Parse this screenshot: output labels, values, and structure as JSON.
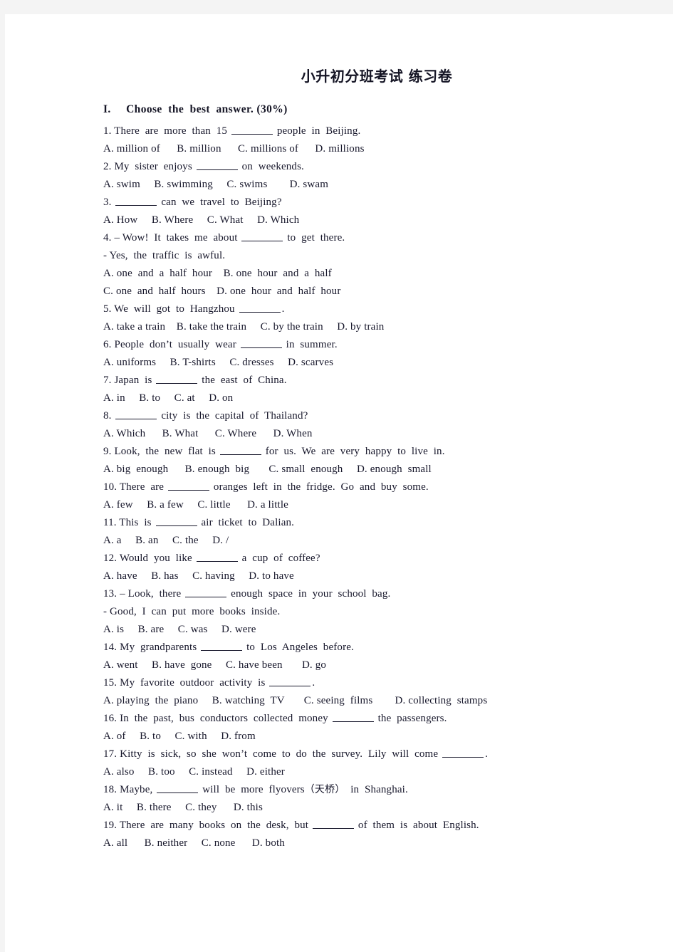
{
  "document": {
    "title": "小升初分班考试 练习卷",
    "section_heading": "I.     Choose  the  best  answer. (30%)",
    "blank_marker": "_______"
  },
  "questions": [
    {
      "number": "1.",
      "stem_before": "1. There  are  more  than  15 ",
      "stem_after": " people  in  Beijing.",
      "options": "A. million of      B. million      C. millions of      D. millions"
    },
    {
      "number": "2.",
      "stem_before": "2. My  sister  enjoys ",
      "stem_after": " on  weekends.",
      "options": "A. swim     B. swimming     C. swims        D. swam"
    },
    {
      "number": "3.",
      "stem_before": "3. ",
      "stem_after": " can  we  travel  to  Beijing?",
      "options": "A. How     B. Where     C. What     D. Which"
    },
    {
      "number": "4.",
      "stem_before": "4. – Wow!  It  takes  me  about ",
      "stem_after": " to  get  there.",
      "reply": "- Yes,  the  traffic  is  awful.",
      "options_line1": "A. one  and  a  half  hour    B. one  hour  and  a  half",
      "options_line2": "C. one  and  half  hours    D. one  hour  and  half  hour"
    },
    {
      "number": "5.",
      "stem_before": "5. We  will  got  to  Hangzhou ",
      "stem_after": ".",
      "options": "A. take a train    B. take the train     C. by the train     D. by train"
    },
    {
      "number": "6.",
      "stem_before": "6. People  don’t  usually  wear ",
      "stem_after": " in  summer.",
      "options": "A. uniforms     B. T-shirts     C. dresses     D. scarves"
    },
    {
      "number": "7.",
      "stem_before": "7. Japan  is ",
      "stem_after": " the  east  of  China.",
      "options": "A. in     B. to     C. at     D. on"
    },
    {
      "number": "8.",
      "stem_before": "8. ",
      "stem_after": " city  is  the  capital  of  Thailand?",
      "options": "A. Which      B. What      C. Where      D. When"
    },
    {
      "number": "9.",
      "stem_before": "9. Look,  the  new  flat  is ",
      "stem_after": " for  us.  We  are  very  happy  to  live  in.",
      "options": "A. big  enough      B. enough  big       C. small  enough     D. enough  small"
    },
    {
      "number": "10.",
      "stem_before": "10. There  are ",
      "stem_after": " oranges  left  in  the  fridge.  Go  and  buy  some.",
      "options": "A. few     B. a few     C. little      D. a little"
    },
    {
      "number": "11.",
      "stem_before": "11. This  is ",
      "stem_after": " air  ticket  to  Dalian.",
      "options": "A. a     B. an     C. the     D. /"
    },
    {
      "number": "12.",
      "stem_before": "12. Would  you  like ",
      "stem_after": " a  cup  of  coffee?",
      "options": "A. have     B. has     C. having     D. to have"
    },
    {
      "number": "13.",
      "stem_before": "13. – Look,  there ",
      "stem_after": " enough  space  in  your  school  bag.",
      "reply": "- Good,  I  can  put  more  books  inside.",
      "options": "A. is     B. are     C. was     D. were"
    },
    {
      "number": "14.",
      "stem_before": "14. My  grandparents ",
      "stem_after": " to  Los  Angeles  before.",
      "options": "A. went     B. have  gone     C. have been       D. go"
    },
    {
      "number": "15.",
      "stem_before": "15. My  favorite  outdoor  activity  is ",
      "stem_after": ".",
      "options": "A. playing  the  piano     B. watching  TV       C. seeing  films        D. collecting  stamps"
    },
    {
      "number": "16.",
      "stem_before": "16. In  the  past,  bus  conductors  collected  money ",
      "stem_after": " the  passengers.",
      "options": "A. of     B. to     C. with     D. from"
    },
    {
      "number": "17.",
      "stem_before": "17. Kitty  is  sick,  so  she  won’t  come  to  do  the  survey.  Lily  will  come ",
      "stem_after": ".",
      "options": "A. also     B. too     C. instead     D. either"
    },
    {
      "number": "18.",
      "stem_before": "18. Maybe, ",
      "stem_mid": " will  be  more  flyovers",
      "cn_note": "（天桥）",
      "stem_after": "  in  Shanghai.",
      "options": "A. it     B. there     C. they      D. this"
    },
    {
      "number": "19.",
      "stem_before": "19. There  are  many  books  on  the  desk,  but ",
      "stem_after": " of  them  is  about  English.",
      "options": "A. all      B. neither     C. none      D. both"
    }
  ],
  "colors": {
    "page_background": "#ffffff",
    "canvas_background": "#f4f4f4",
    "text": "#17172b"
  }
}
